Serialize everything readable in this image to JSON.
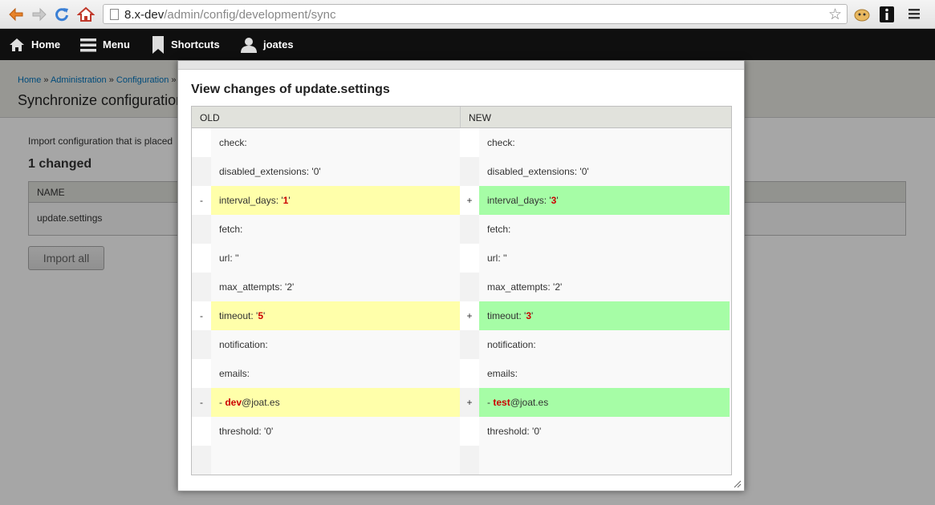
{
  "browser": {
    "url_host": "8.x-dev",
    "url_path": "/admin/config/development/sync"
  },
  "toolbar": {
    "home_label": "Home",
    "menu_label": "Menu",
    "shortcuts_label": "Shortcuts",
    "user_label": "joates"
  },
  "page": {
    "breadcrumb": [
      {
        "label": "Home"
      },
      {
        "label": "Administration"
      },
      {
        "label": "Configuration"
      }
    ],
    "breadcrumb_sep": " » ",
    "title": "Synchronize configuration",
    "description": "Import configuration that is placed",
    "changed_heading": "1 changed",
    "table_header": "NAME",
    "table_row": "update.settings",
    "import_button": "Import all"
  },
  "dialog": {
    "heading": "View changes of update.settings",
    "col_old": "OLD",
    "col_new": "NEW",
    "rows": [
      {
        "type": "same",
        "old": [
          "check:"
        ],
        "new": [
          "check:"
        ]
      },
      {
        "type": "same",
        "old": [
          "disabled_extensions: '0'"
        ],
        "new": [
          "disabled_extensions: '0'"
        ]
      },
      {
        "type": "change",
        "old_mark": "-",
        "new_mark": "+",
        "old": [
          "interval_days: '",
          "1",
          "'"
        ],
        "new": [
          "interval_days: '",
          "3",
          "'"
        ]
      },
      {
        "type": "same",
        "old": [
          "fetch:"
        ],
        "new": [
          "fetch:"
        ]
      },
      {
        "type": "same",
        "old": [
          "url: ''"
        ],
        "new": [
          "url: ''"
        ]
      },
      {
        "type": "same",
        "old": [
          "max_attempts: '2'"
        ],
        "new": [
          "max_attempts: '2'"
        ]
      },
      {
        "type": "change",
        "old_mark": "-",
        "new_mark": "+",
        "old": [
          "timeout: '",
          "5",
          "'"
        ],
        "new": [
          "timeout: '",
          "3",
          "'"
        ]
      },
      {
        "type": "same",
        "old": [
          "notification:"
        ],
        "new": [
          "notification:"
        ]
      },
      {
        "type": "same",
        "old": [
          "emails:"
        ],
        "new": [
          "emails:"
        ]
      },
      {
        "type": "change",
        "old_mark": "-",
        "new_mark": "+",
        "old": [
          "- ",
          "dev",
          "@joat.es"
        ],
        "new": [
          "- ",
          "test",
          "@joat.es"
        ]
      },
      {
        "type": "same",
        "old": [
          "threshold: '0'"
        ],
        "new": [
          "threshold: '0'"
        ]
      },
      {
        "type": "same",
        "old": [
          ""
        ],
        "new": [
          ""
        ]
      }
    ]
  },
  "colors": {
    "deleted_bg": "#ffffaa",
    "added_bg": "#a6fda6",
    "highlight": "#cc0000",
    "toolbar_bg": "#0f0f0f",
    "link": "#0074bd"
  }
}
